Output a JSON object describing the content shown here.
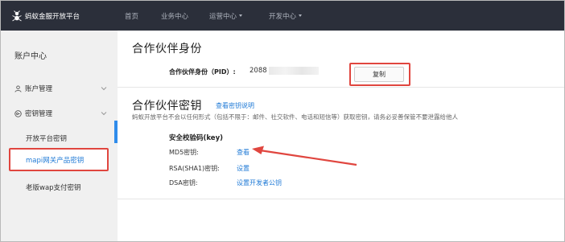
{
  "topbar": {
    "brand": "蚂蚁金服开放平台",
    "nav": [
      {
        "label": "首页",
        "has_caret": false
      },
      {
        "label": "业务中心",
        "has_caret": false
      },
      {
        "label": "运营中心",
        "has_caret": true
      },
      {
        "label": "开发中心",
        "has_caret": true
      }
    ]
  },
  "sidebar": {
    "title": "账户中心",
    "groups": [
      {
        "label": "账户管理",
        "icon": "user-icon"
      },
      {
        "label": "密钥管理",
        "icon": "key-circle-icon"
      }
    ],
    "items": [
      {
        "label": "开放平台密钥",
        "active": false
      },
      {
        "label": "mapi网关产品密钥",
        "active": true
      },
      {
        "label": "老版wap支付密钥",
        "active": false
      }
    ]
  },
  "main": {
    "partner_id_title": "合作伙伴身份",
    "pid_label": "合作伙伴身份（PID）:",
    "pid_value": "2088",
    "copy_button": "复制",
    "partner_key_title": "合作伙伴密钥",
    "key_help_link": "查看密钥说明",
    "description": "蚂蚁开放平台不会以任何形式（包括不限于：邮件、社交软件、电话和短信等）获取密钥，请务必妥善保管不要泄露给他人",
    "security_title": "安全校验码(key)",
    "keys": [
      {
        "label": "MD5密钥:",
        "action": "查看"
      },
      {
        "label": "RSA(SHA1)密钥:",
        "action": "设置"
      },
      {
        "label": "DSA密钥:",
        "action": "设置开发者公钥"
      }
    ]
  },
  "colors": {
    "topbar_bg": "#2b2f3a",
    "highlight_red": "#e0463f",
    "link_blue": "#1f7ad6",
    "active_bar": "#2f8ceb",
    "sidebar_bg": "#f0f0f0"
  }
}
